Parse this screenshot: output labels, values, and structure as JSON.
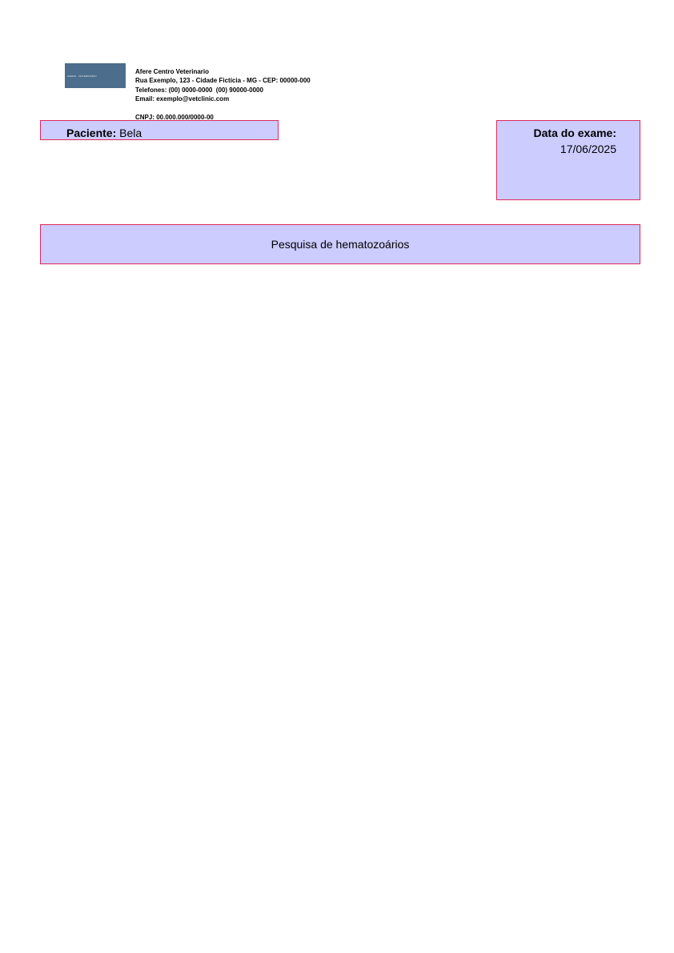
{
  "header": {
    "logo_text": "AFERE · VETERINÁRIO",
    "clinic_lines": [
      "Afere Centro Veterinario",
      "Rua Exemplo, 123 - Cidade Fictícia - MG - CEP: 00000-000",
      "Telefones: (00) 0000-0000  (00) 90000-0000",
      "Email: exemplo@vetclinic.com"
    ],
    "cnpj": "CNPJ: 00.000.000/0000-00"
  },
  "patient": {
    "label": "Paciente:",
    "name": "Bela"
  },
  "exam_date": {
    "label": "Data do exame:",
    "value": "17/06/2025"
  },
  "exam": {
    "title": "Pesquisa de hematozoários"
  },
  "colors": {
    "box_fill": "#ccccff",
    "box_border": "#e0285a",
    "logo_bg": "#4c6d8b"
  }
}
